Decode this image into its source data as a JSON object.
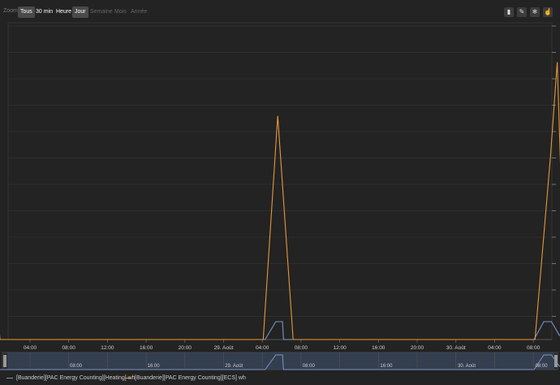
{
  "toolbar": {
    "zoom_label": "Zoom",
    "buttons": [
      {
        "label": "Tous",
        "state": "active"
      },
      {
        "label": "30 min",
        "state": "enabled"
      },
      {
        "label": "Heure",
        "state": "enabled"
      },
      {
        "label": "Jour",
        "state": "active"
      },
      {
        "label": "Semaine",
        "state": "disabled"
      },
      {
        "label": "Mois",
        "state": "disabled"
      },
      {
        "label": "Année",
        "state": "disabled"
      }
    ],
    "tools": [
      {
        "icon": "bar-chart-icon",
        "glyph": "▮"
      },
      {
        "icon": "pencil-icon",
        "glyph": "✎"
      },
      {
        "icon": "snowflake-icon",
        "glyph": "❄"
      },
      {
        "icon": "pointer-hand-icon",
        "glyph": "☝"
      }
    ]
  },
  "colors": {
    "background": "#232323",
    "heating": "#7b95c8",
    "ecs": "#e8963a",
    "grid": "#3a3a3a",
    "navigator_fill": "#3a4e6e"
  },
  "chart_data": {
    "type": "line",
    "x_ticks": [
      "04:00",
      "08:00",
      "12:00",
      "16:00",
      "20:00",
      "29. Août",
      "04:00",
      "08:00",
      "12:00",
      "16:00",
      "20:00",
      "30. Août",
      "04:00",
      "08:00"
    ],
    "series": [
      {
        "name": "[Buanderie][PAC Energy Counting][Heating] wh",
        "color": "#7b95c8",
        "x_hours": [
          -1.8,
          -0.6,
          0.1,
          0.2,
          28.3,
          29.4,
          30.1,
          30.2,
          56.1,
          57.1,
          57.9,
          58.7,
          59.2
        ],
        "values": [
          0,
          0.08,
          0.08,
          0,
          0,
          0.08,
          0.08,
          0,
          0,
          0.08,
          0.08,
          0.02,
          0
        ]
      },
      {
        "name": "[Buanderie][PAC Energy Counting][ECS] wh",
        "color": "#e8963a",
        "x_hours": [
          -1.4,
          -0.9,
          0.9,
          28.1,
          29.6,
          31.2,
          56.2,
          57.8,
          58.5,
          59.4
        ],
        "values": [
          0,
          1.0,
          0,
          0,
          1.0,
          0,
          0,
          0.82,
          1.24,
          0
        ]
      }
    ],
    "y_ticks_visible": true,
    "navigator": true
  },
  "legend": {
    "items": [
      "[Buanderie][PAC Energy Counting][Heating] wh",
      "[Buanderie][PAC Energy Counting][ECS] wh"
    ]
  }
}
